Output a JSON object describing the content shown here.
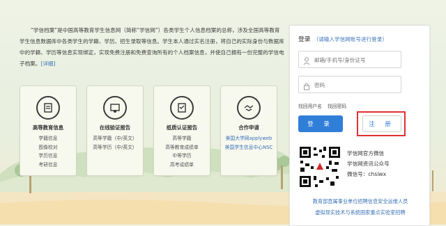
{
  "intro": {
    "text": "“学信档案”是中国高等教育学生信息网（简称“学信网”）各类学生个人信息档案的总称，涉及全国高等教育学生信息数据库中各类学生的学籍、学历、招生录取等信息。学生本人通过实名注册，将自己的实际身份与数据库中的学籍、学历等信息实现绑定，实现免费注册和免费查询所有的个人档案信息，并使自己拥有一份完整的学信电子档案。",
    "more": "[详细]"
  },
  "cards": [
    {
      "title": "高等教育信息",
      "items": [
        "学籍信息",
        "图像校对",
        "学历信息",
        "考研信息"
      ],
      "icon": "document-icon"
    },
    {
      "title": "在线验证报告",
      "items": [
        "高等学籍（中/英文）",
        "高等学历（中/英文）"
      ],
      "icon": "certificate-icon"
    },
    {
      "title": "纸质认证报告",
      "items": [
        "高等学籍",
        "高等教育成绩单",
        "中等学历",
        "高考成绩单"
      ],
      "icon": "paper-report-icon"
    },
    {
      "title": "合作申请",
      "items": [
        "美国大学网applyweb",
        "美国学生信息中心NSC"
      ],
      "icon": "handshake-icon"
    }
  ],
  "login": {
    "title": "登录",
    "hint": "（请输入学信网账号进行登录）",
    "username_placeholder": "邮箱/手机号/身份证号",
    "password_placeholder": "密码",
    "find_username": "找回用户名",
    "find_password": "找回密码",
    "login_button": "登 录",
    "register_button": "注 册"
  },
  "wechat": {
    "line1": "学信网官方微信",
    "line2": "学信网资讯公众号",
    "line3": "微信号：chsiwx"
  },
  "footer": {
    "line1": "教育部直属事业单位招聘信息安全运维人员",
    "line2": "虚拟现实技术与系统国家重点实验室招聘"
  },
  "colors": {
    "accent": "#2f7ed8",
    "highlight_border": "#e03030",
    "link": "#3b73b9"
  }
}
